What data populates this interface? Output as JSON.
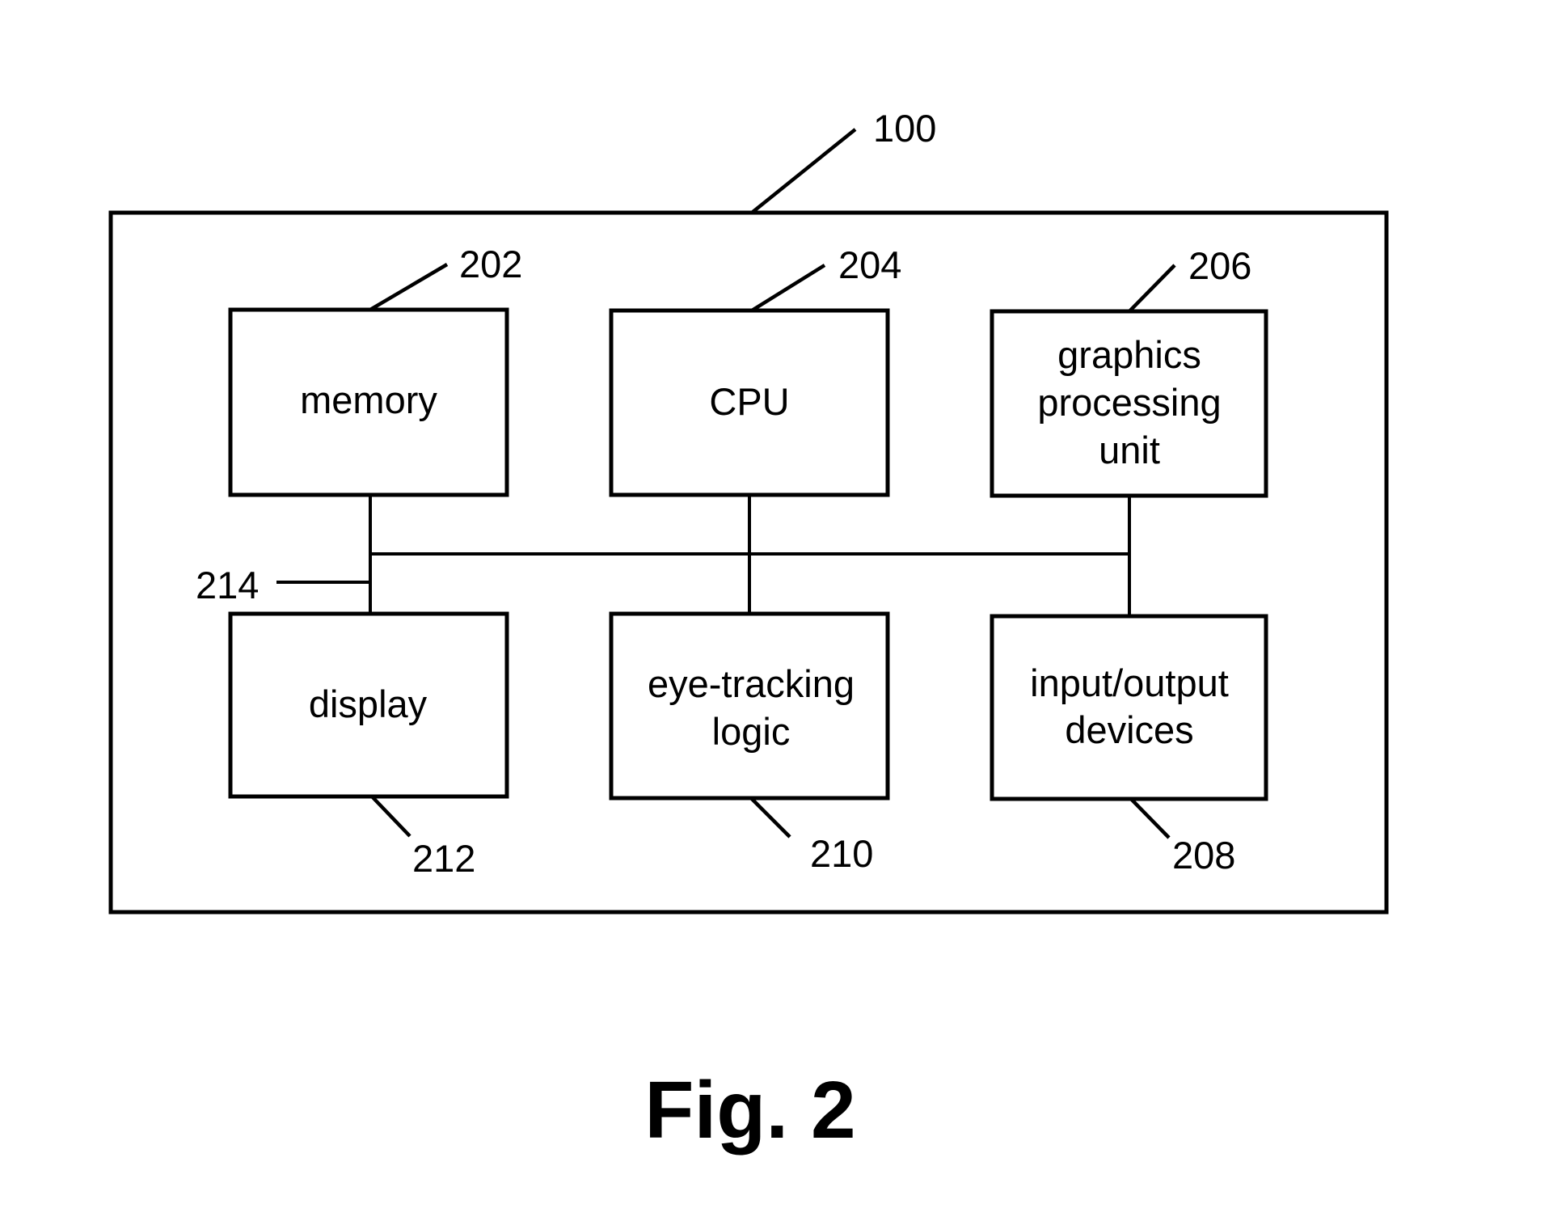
{
  "diagram": {
    "system": {
      "ref": "100"
    },
    "components": [
      {
        "id": "memory",
        "ref": "202",
        "lines": [
          "memory"
        ]
      },
      {
        "id": "cpu",
        "ref": "204",
        "lines": [
          "CPU"
        ]
      },
      {
        "id": "gpu",
        "ref": "206",
        "lines": [
          "graphics",
          "processing",
          "unit"
        ]
      },
      {
        "id": "display",
        "ref": "212",
        "lines": [
          "display"
        ]
      },
      {
        "id": "eye-tracking",
        "ref": "210",
        "lines": [
          "eye-tracking",
          "logic"
        ]
      },
      {
        "id": "io",
        "ref": "208",
        "lines": [
          "input/output",
          "devices"
        ]
      }
    ],
    "bus": {
      "ref": "214"
    },
    "caption": "Fig. 2"
  },
  "colors": {
    "stroke": "#000000",
    "background": "#ffffff"
  }
}
